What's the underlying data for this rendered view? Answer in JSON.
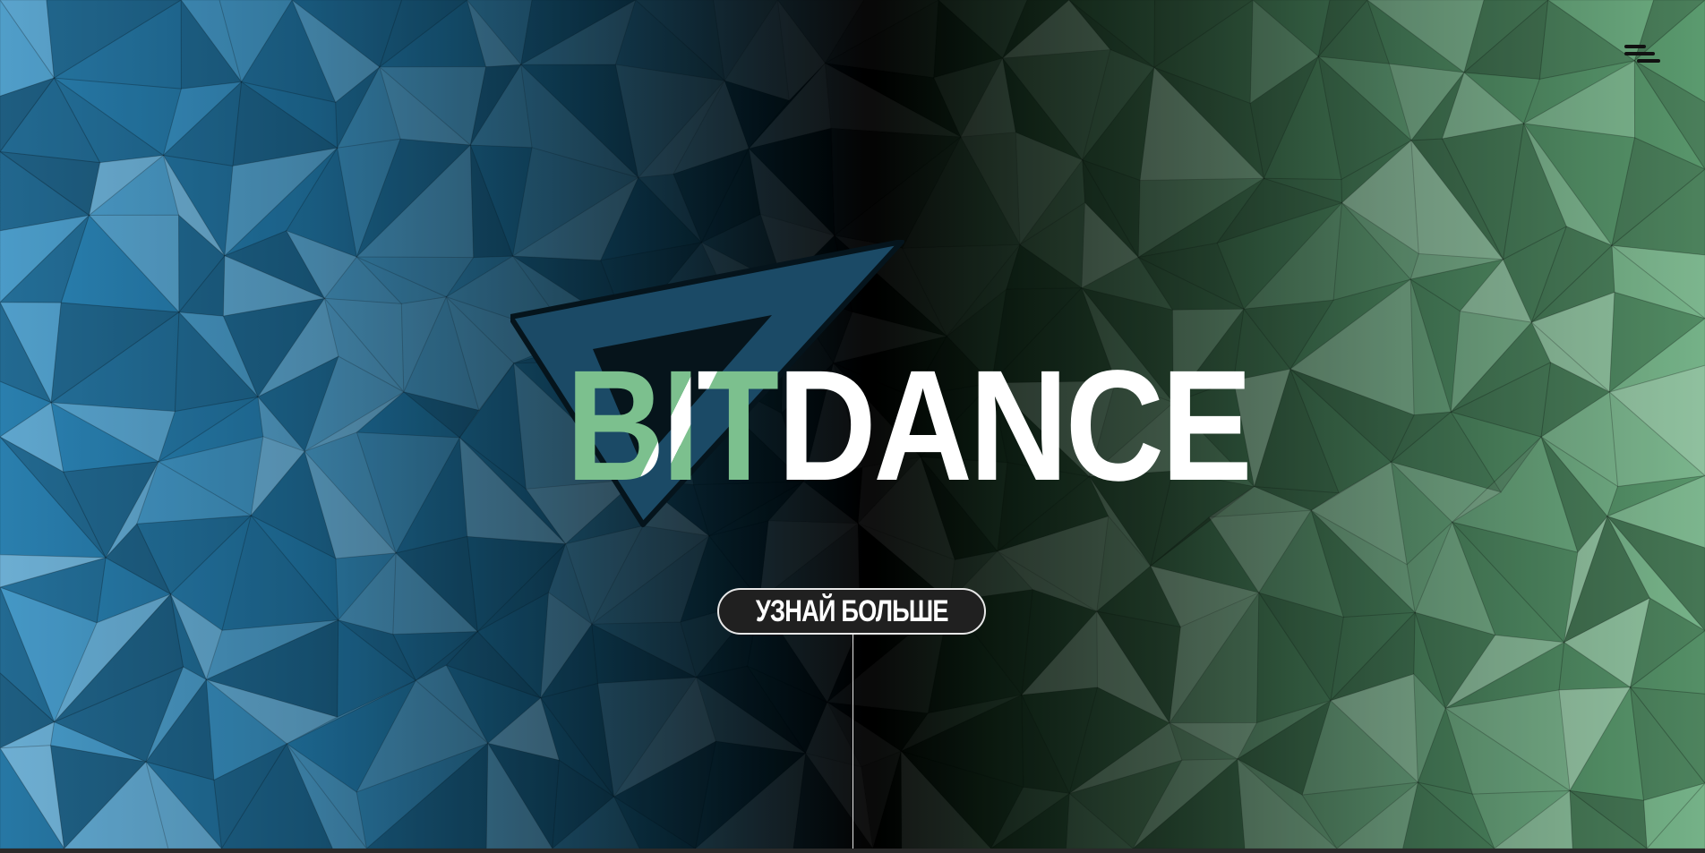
{
  "brand": {
    "name_accent": "BIT",
    "name_rest": "DANCE"
  },
  "hero": {
    "cta_label": "УЗНАЙ БОЛЬШЕ"
  },
  "icons": {
    "menu": "hamburger-menu-icon",
    "logo_mark": "triangle-logo-icon"
  },
  "colors": {
    "left_accent": "#2e8bbf",
    "right_accent": "#63a878",
    "logo_triangle": "#1b4a66",
    "logo_text": "#ffffff",
    "logo_text_accent": "#7cc08e",
    "button_bg": "#202020"
  }
}
